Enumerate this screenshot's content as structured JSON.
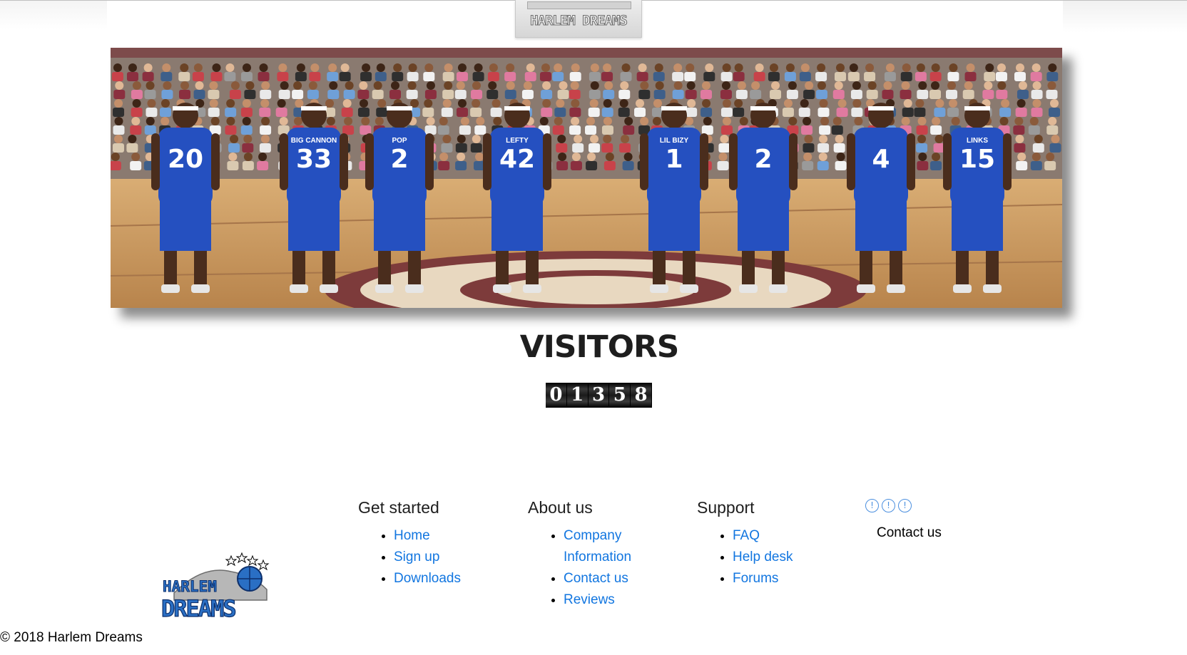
{
  "header": {
    "logo_text": "HARLEM DREAMS"
  },
  "banner": {
    "alt": "Harlem Dreams basketball team on court",
    "jerseys": [
      "20",
      "33",
      "2",
      "42",
      "1",
      "2",
      "4",
      "15"
    ],
    "jersey_names": [
      "",
      "BIG CANNON",
      "POP",
      "LEFTY",
      "LIL BIZY",
      "",
      "",
      "LINKS"
    ]
  },
  "visitors": {
    "title": "VISITORS",
    "digits": [
      "0",
      "1",
      "3",
      "5",
      "8"
    ]
  },
  "footer": {
    "logo_text_top": "HARLEM",
    "logo_text_bottom": "DREAMS",
    "get_started": {
      "heading": "Get started",
      "links": [
        "Home",
        "Sign up",
        "Downloads"
      ]
    },
    "about_us": {
      "heading": "About us",
      "links": [
        "Company Information",
        "Contact us",
        "Reviews"
      ]
    },
    "support": {
      "heading": "Support",
      "links": [
        "FAQ",
        "Help desk",
        "Forums"
      ]
    },
    "social": {
      "icons": [
        "social-icon-1",
        "social-icon-2",
        "social-icon-3"
      ],
      "contact_label": "Contact us"
    },
    "copyright": "© 2018 Harlem Dreams"
  },
  "colors": {
    "link": "#1276e0",
    "jersey": "#2550c0",
    "court": "#c99a62"
  }
}
